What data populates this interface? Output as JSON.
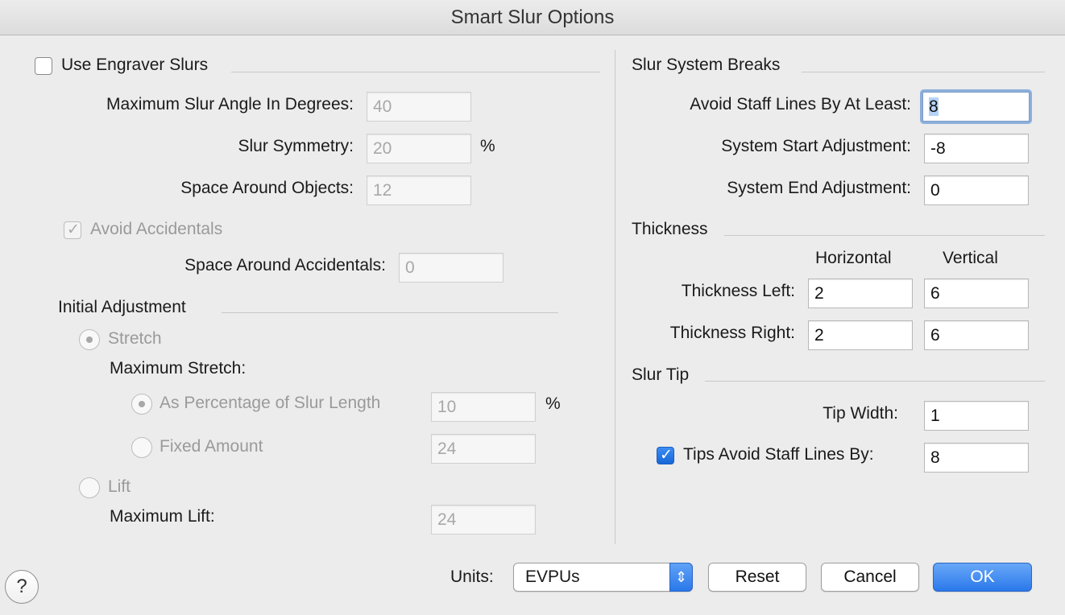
{
  "window": {
    "title": "Smart Slur Options"
  },
  "left": {
    "use_engraver": {
      "label": "Use Engraver Slurs",
      "checked": false
    },
    "max_angle": {
      "label": "Maximum Slur Angle In Degrees:",
      "value": "40"
    },
    "symmetry": {
      "label": "Slur Symmetry:",
      "value": "20",
      "unit": "%"
    },
    "space_objects": {
      "label": "Space Around Objects:",
      "value": "12"
    },
    "avoid_accidentals": {
      "label": "Avoid Accidentals",
      "checked": true,
      "check_glyph": "✓"
    },
    "space_accidentals": {
      "label": "Space Around Accidentals:",
      "value": "0"
    },
    "initial_adjustment": {
      "heading": "Initial Adjustment",
      "stretch_label": "Stretch",
      "max_stretch_label": "Maximum Stretch:",
      "as_percentage": {
        "label": "As Percentage of Slur Length",
        "value": "10",
        "unit": "%"
      },
      "fixed_amount": {
        "label": "Fixed Amount",
        "value": "24"
      },
      "lift_label": "Lift",
      "max_lift": {
        "label": "Maximum Lift:",
        "value": "24"
      }
    }
  },
  "right": {
    "system_breaks": {
      "heading": "Slur System Breaks",
      "avoid_staff": {
        "label": "Avoid Staff Lines By At Least:",
        "value": "8"
      },
      "start_adj": {
        "label": "System Start Adjustment:",
        "value": "-8"
      },
      "end_adj": {
        "label": "System End Adjustment:",
        "value": "0"
      }
    },
    "thickness": {
      "heading": "Thickness",
      "col_horizontal": "Horizontal",
      "col_vertical": "Vertical",
      "left": {
        "label": "Thickness Left:",
        "h": "2",
        "v": "6"
      },
      "right": {
        "label": "Thickness Right:",
        "h": "2",
        "v": "6"
      }
    },
    "slur_tip": {
      "heading": "Slur Tip",
      "tip_width": {
        "label": "Tip Width:",
        "value": "1"
      },
      "tips_avoid": {
        "label": "Tips Avoid Staff Lines By:",
        "value": "8",
        "checked": true,
        "check_glyph": "✓"
      }
    }
  },
  "footer": {
    "help_label": "?",
    "units_label": "Units:",
    "units_value": "EVPUs",
    "stepper_glyph": "⇕",
    "reset_label": "Reset",
    "cancel_label": "Cancel",
    "ok_label": "OK"
  },
  "colors": {
    "accent": "#2a78ea",
    "focus": "#8cafdc"
  }
}
